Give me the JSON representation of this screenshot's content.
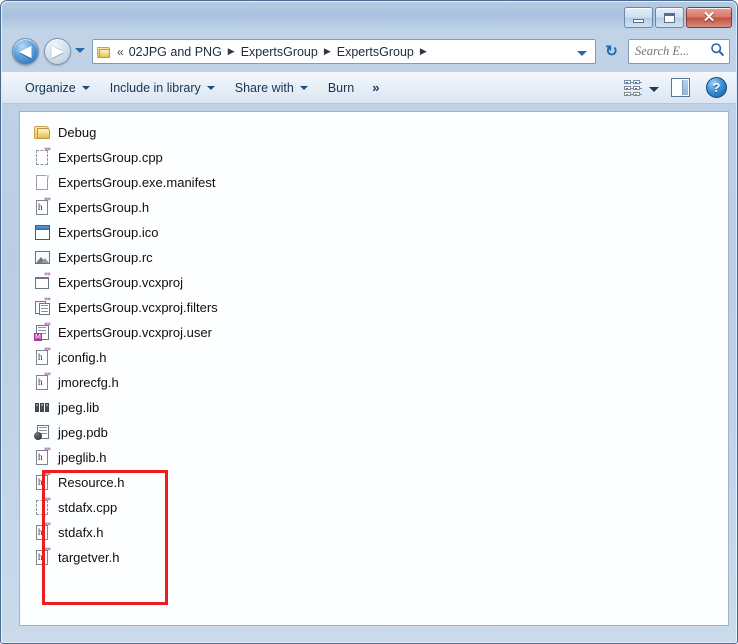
{
  "window": {
    "title": "",
    "controls": {
      "minimize": "—",
      "maximize": "□",
      "close": "✕",
      "minimize_name": "minimize-button",
      "maximize_name": "maximize-button",
      "close_name": "close-button"
    }
  },
  "navigation": {
    "back_glyph": "◀",
    "forward_glyph": "▶",
    "recent_pages_label": "▾",
    "refresh_glyph": "↻"
  },
  "address": {
    "leading_chevrons": "«",
    "breadcrumbs": [
      {
        "label": "02JPG and PNG"
      },
      {
        "label": "ExpertsGroup"
      },
      {
        "label": "ExpertsGroup"
      }
    ],
    "separator": "▶",
    "dropdown_label": "▾",
    "folder_icon": "folder-icon"
  },
  "search": {
    "placeholder": "Search E...",
    "value": "",
    "icon": "search-icon"
  },
  "toolbar": {
    "items": [
      {
        "label": "Organize",
        "caret": true,
        "name": "toolbar-organize"
      },
      {
        "label": "Include in library",
        "caret": true,
        "name": "toolbar-include-in-library"
      },
      {
        "label": "Share with",
        "caret": true,
        "name": "toolbar-share-with"
      },
      {
        "label": "Burn",
        "caret": false,
        "name": "toolbar-burn"
      }
    ],
    "overflow_label": "»",
    "view_icon": "change-view-icon",
    "view_dropdown_label": "▾",
    "preview_pane_icon": "preview-pane-icon",
    "help_label": "?"
  },
  "files": [
    {
      "name": "Debug",
      "icon": "folder-icon",
      "type": "folder"
    },
    {
      "name": "ExpertsGroup.cpp",
      "icon": "cpp-file-icon",
      "type": "cpp"
    },
    {
      "name": "ExpertsGroup.exe.manifest",
      "icon": "manifest-file-icon",
      "type": "manifest"
    },
    {
      "name": "ExpertsGroup.h",
      "icon": "header-file-icon",
      "type": "h"
    },
    {
      "name": "ExpertsGroup.ico",
      "icon": "ico-file-icon",
      "type": "ico"
    },
    {
      "name": "ExpertsGroup.rc",
      "icon": "resource-script-icon",
      "type": "rc"
    },
    {
      "name": "ExpertsGroup.vcxproj",
      "icon": "vcxproj-file-icon",
      "type": "proj"
    },
    {
      "name": "ExpertsGroup.vcxproj.filters",
      "icon": "vcxproj-filters-icon",
      "type": "filters"
    },
    {
      "name": "ExpertsGroup.vcxproj.user",
      "icon": "vcxproj-user-icon",
      "type": "user"
    },
    {
      "name": "jconfig.h",
      "icon": "header-file-icon",
      "type": "h",
      "highlighted": true
    },
    {
      "name": "jmorecfg.h",
      "icon": "header-file-icon",
      "type": "h",
      "highlighted": true
    },
    {
      "name": "jpeg.lib",
      "icon": "lib-file-icon",
      "type": "lib",
      "highlighted": true
    },
    {
      "name": "jpeg.pdb",
      "icon": "pdb-file-icon",
      "type": "pdb",
      "highlighted": true
    },
    {
      "name": "jpeglib.h",
      "icon": "header-file-icon",
      "type": "h",
      "highlighted": true
    },
    {
      "name": "Resource.h",
      "icon": "header-file-icon",
      "type": "h"
    },
    {
      "name": "stdafx.cpp",
      "icon": "cpp-file-icon",
      "type": "cpp"
    },
    {
      "name": "stdafx.h",
      "icon": "header-file-icon",
      "type": "h"
    },
    {
      "name": "targetver.h",
      "icon": "header-file-icon",
      "type": "h"
    }
  ],
  "annotation": {
    "highlight_color": "#ee1c1c",
    "highlight_items": [
      "jconfig.h",
      "jmorecfg.h",
      "jpeg.lib",
      "jpeg.pdb",
      "jpeglib.h"
    ]
  },
  "colors": {
    "accent": "#1f66ad",
    "frame": "#b9cde3",
    "pane_background": "#fdfeff",
    "close_button": "#c0503f",
    "annotation": "#ee1c1c"
  }
}
